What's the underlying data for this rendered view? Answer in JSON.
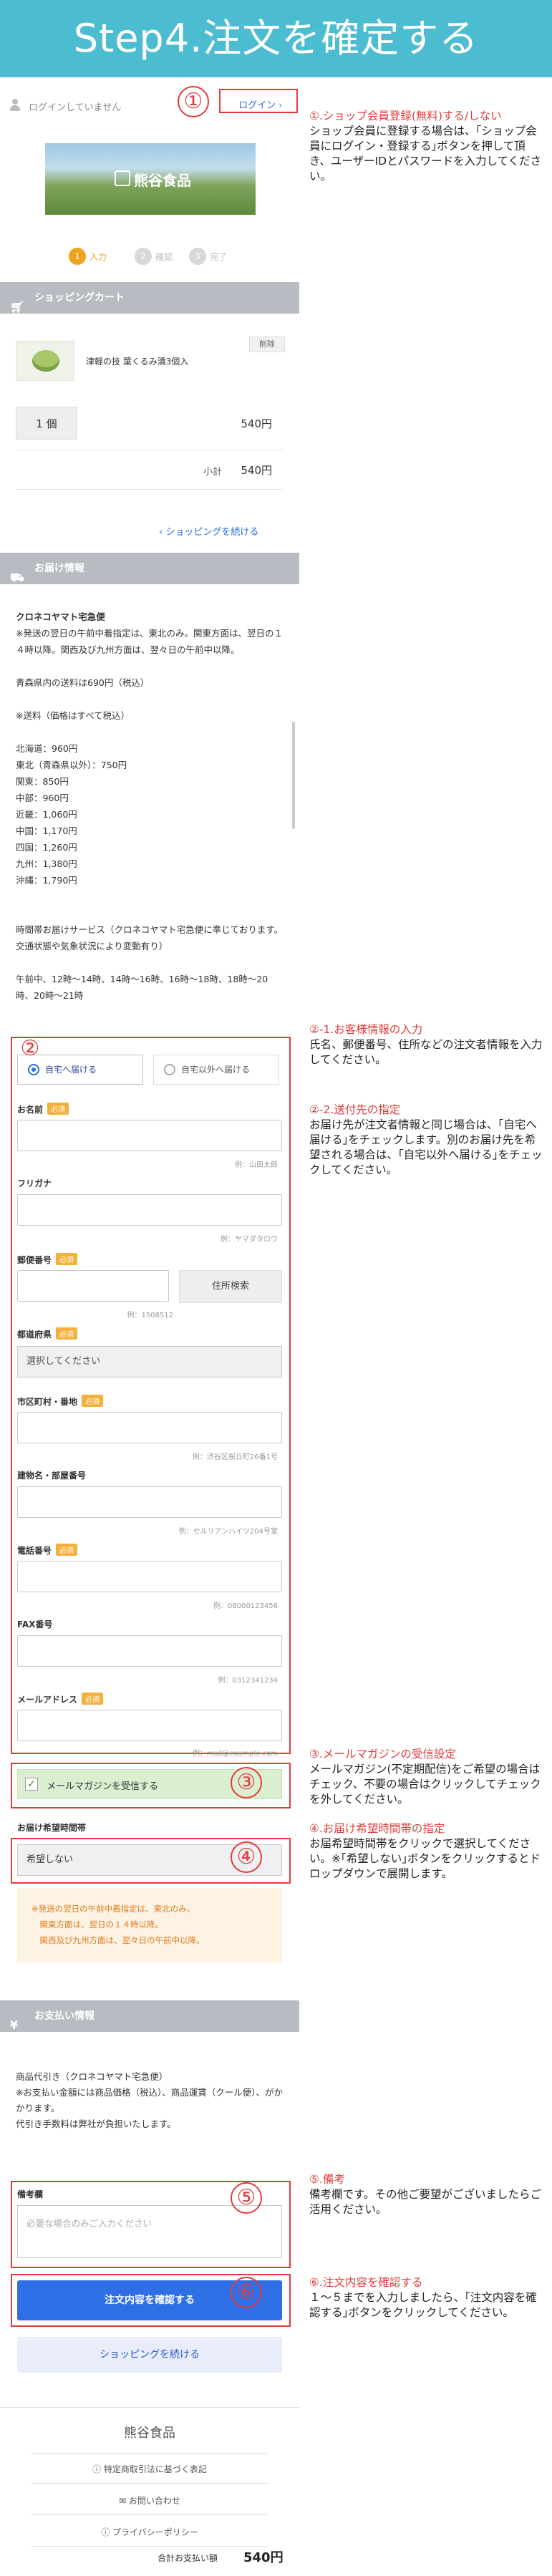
{
  "banner": {
    "title": "Step4.注文を確定する"
  },
  "header": {
    "login_status": "ログインしていません",
    "login_label": "ログイン"
  },
  "logo": {
    "name": "熊谷食品"
  },
  "steps": [
    {
      "num": "1",
      "label": "入力"
    },
    {
      "num": "2",
      "label": "確認"
    },
    {
      "num": "3",
      "label": "完了"
    }
  ],
  "cart": {
    "heading": "ショッピングカート",
    "item_name": "津軽の技 葉くるみ漬3個入",
    "delete_label": "削除",
    "quantity": "1 個",
    "item_price": "540円",
    "subtotal_label": "小計",
    "subtotal": "540円",
    "continue_link": "ショッピングを続ける"
  },
  "shipping": {
    "heading": "お届け情報",
    "carrier": "クロネコヤマト宅急便",
    "details": "※発送の翌日の午前中着指定は、東北のみ。関東方面は、翌日の１４時以降。関西及び九州方面は、翌々日の午前中以降。\n\n青森県内の送料は690円（税込）\n\n※送料（価格はすべて税込）\n\n北海道：960円\n東北（青森県以外）：750円\n関東：850円\n中部：960円\n近畿：1,060円\n中国：1,170円\n四国：1,260円\n九州：1,380円\n沖縄：1,790円\n\n\n時間帯お届けサービス（クロネコヤマト宅急便に準じております。交通状態や気象状況により変動有り）\n\n午前中、12時〜14時、14時〜16時、16時〜18時、18時〜20時、20時〜21時"
  },
  "form": {
    "radio_self": "自宅へ届ける",
    "radio_other": "自宅以外へ届ける",
    "required": "必須",
    "name_label": "お名前",
    "name_hint": "例：山田太郎",
    "kana_label": "フリガナ",
    "kana_hint": "例：ヤマダタロウ",
    "zip_label": "郵便番号",
    "zip_hint": "例：1508512",
    "zip_button": "住所検索",
    "pref_label": "都道府県",
    "pref_value": "選択してください",
    "city_label": "市区町村・番地",
    "city_hint": "例：渋谷区桜丘町26番1号",
    "building_label": "建物名・部屋番号",
    "building_hint": "例：セルリアンハイツ204号室",
    "tel_label": "電話番号",
    "tel_hint": "例：08000123456",
    "fax_label": "FAX番号",
    "fax_hint": "例：0312341234",
    "email_label": "メールアドレス",
    "email_hint": "例：mail@example.com"
  },
  "magazine": {
    "label": "メールマガジンを受信する"
  },
  "delivery_time": {
    "label": "お届け希望時間帯",
    "value": "希望しない",
    "notice": "※発送の翌日の午前中着指定は、東北のみ。\n　関東方面は、翌日の１４時以降。\n　関西及び九州方面は、翌々日の午前中以降。"
  },
  "payment": {
    "heading": "お支払い情報",
    "text": "商品代引き（クロネコヤマト宅急便）\n※お支払い金額には商品価格（税込）、商品運賃（クール便）、がかかります。\n代引き手数料は弊社が負担いたします。"
  },
  "remarks": {
    "label": "備考欄",
    "placeholder": "必要な場合のみご入力ください"
  },
  "actions": {
    "confirm": "注文内容を確認する",
    "continue": "ショッピングを続ける"
  },
  "footer": {
    "name": "熊谷食品",
    "links": [
      "特定商取引法に基づく表記",
      "お問い合わせ",
      "プライバシーポリシー"
    ],
    "total_label": "合計お支払い額",
    "total": "540円"
  },
  "annotations": [
    {
      "title": "①.ショップ会員登録(無料)する/しない",
      "body": "ショップ会員に登録する場合は、｢ショップ会員にログイン・登録する｣ボタンを押して頂き、ユーザーIDとパスワードを入力してください。"
    },
    {
      "title": "②-1.お客様情報の入力",
      "body": "氏名、郵便番号、住所などの注文者情報を入力してください。"
    },
    {
      "title": "②-2.送付先の指定",
      "body": "お届け先が注文者情報と同じ場合は、｢自宅へ届ける｣をチェックします。別のお届け先を希望される場合は、｢自宅以外へ届ける｣をチェックしてください。"
    },
    {
      "title": "③.メールマガジンの受信設定",
      "body": "メールマガジン(不定期配信)をご希望の場合はチェック、不要の場合はクリックしてチェックを外してください。"
    },
    {
      "title": "④.お届け希望時間帯の指定",
      "body": "お届希望時間帯をクリックで選択してください。※｢希望しない｣ボタンをクリックするとドロップダウンで展開します。"
    },
    {
      "title": "⑤.備考",
      "body": "備考欄です。その他ご要望がございましたらご活用ください。"
    },
    {
      "title": "⑥.注文内容を確認する",
      "body": "１〜５までを入力しましたら、｢注文内容を確認する｣ボタンをクリックしてください。"
    }
  ],
  "badges": [
    "①",
    "②",
    "③",
    "④",
    "⑤",
    "⑥"
  ],
  "colors": {
    "banner": "#4cbdd0",
    "accent_red": "#e33b3b",
    "primary_blue": "#2f6fe6",
    "step_active": "#f0a21f"
  }
}
